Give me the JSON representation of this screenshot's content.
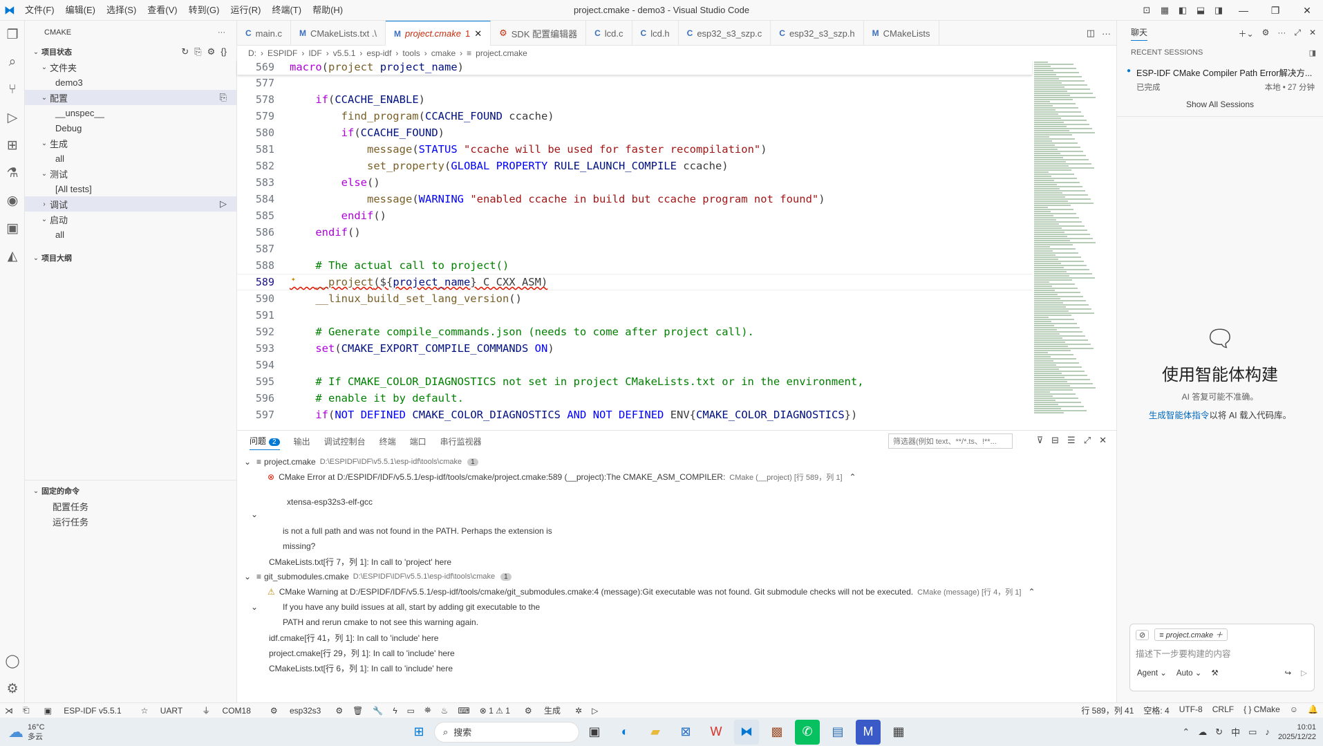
{
  "window": {
    "title": "project.cmake - demo3 - Visual Studio Code",
    "menu": [
      "文件(F)",
      "编辑(E)",
      "选择(S)",
      "查看(V)",
      "转到(G)",
      "运行(R)",
      "终端(T)",
      "帮助(H)"
    ]
  },
  "sidebar": {
    "header": "CMAKE",
    "project_status": "项目状态",
    "folder": "文件夹",
    "folder_item": "demo3",
    "config": "配置",
    "config_items": [
      "__unspec__",
      "Debug"
    ],
    "build": "生成",
    "build_item": "all",
    "test": "测试",
    "test_item": "[All tests]",
    "debug": "调试",
    "launch": "启动",
    "launch_item": "all",
    "outline": "项目大纲",
    "pinned": "固定的命令",
    "pinned_items": [
      "配置任务",
      "运行任务"
    ]
  },
  "tabs": [
    {
      "icon": "C",
      "label": "main.c"
    },
    {
      "icon": "M",
      "label": "CMakeLists.txt .\\"
    },
    {
      "icon": "M",
      "label": "project.cmake",
      "badge": "1"
    },
    {
      "icon": "⚙",
      "label": "SDK 配置编辑器"
    },
    {
      "icon": "C",
      "label": "lcd.c"
    },
    {
      "icon": "C",
      "label": "lcd.h"
    },
    {
      "icon": "C",
      "label": "esp32_s3_szp.c"
    },
    {
      "icon": "C",
      "label": "esp32_s3_szp.h"
    },
    {
      "icon": "M",
      "label": "CMakeLists"
    }
  ],
  "breadcrumbs": [
    "D:",
    "ESPIDF",
    "IDF",
    "v5.5.1",
    "esp-idf",
    "tools",
    "cmake",
    "project.cmake"
  ],
  "sticky_line": {
    "num": "569",
    "text": "macro(project project_name)"
  },
  "code_lines": [
    {
      "num": "577",
      "text": ""
    },
    {
      "num": "578",
      "text": "    if(CCACHE_ENABLE)"
    },
    {
      "num": "579",
      "text": "        find_program(CCACHE_FOUND ccache)"
    },
    {
      "num": "580",
      "text": "        if(CCACHE_FOUND)"
    },
    {
      "num": "581",
      "text": "            message(STATUS \"ccache will be used for faster recompilation\")"
    },
    {
      "num": "582",
      "text": "            set_property(GLOBAL PROPERTY RULE_LAUNCH_COMPILE ccache)"
    },
    {
      "num": "583",
      "text": "        else()"
    },
    {
      "num": "584",
      "text": "            message(WARNING \"enabled ccache in build but ccache program not found\")"
    },
    {
      "num": "585",
      "text": "        endif()"
    },
    {
      "num": "586",
      "text": "    endif()"
    },
    {
      "num": "587",
      "text": ""
    },
    {
      "num": "588",
      "text": "    # The actual call to project()"
    },
    {
      "num": "589",
      "text": "    __project(${project_name} C CXX ASM)"
    },
    {
      "num": "590",
      "text": "    __linux_build_set_lang_version()"
    },
    {
      "num": "591",
      "text": ""
    },
    {
      "num": "592",
      "text": "    # Generate compile_commands.json (needs to come after project call)."
    },
    {
      "num": "593",
      "text": "    set(CMAKE_EXPORT_COMPILE_COMMANDS ON)"
    },
    {
      "num": "594",
      "text": ""
    },
    {
      "num": "595",
      "text": "    # If CMAKE_COLOR_DIAGNOSTICS not set in project CMakeLists.txt or in the environment,"
    },
    {
      "num": "596",
      "text": "    # enable it by default."
    },
    {
      "num": "597",
      "text": "    if(NOT DEFINED CMAKE_COLOR_DIAGNOSTICS AND NOT DEFINED ENV{CMAKE_COLOR_DIAGNOSTICS})"
    }
  ],
  "panel": {
    "tabs": [
      "问题",
      "输出",
      "调试控制台",
      "终端",
      "端口",
      "串行监视器"
    ],
    "problems_count": "2",
    "filter_placeholder": "筛选器(例如 text、**/*.ts、!**...",
    "file1": {
      "name": "project.cmake",
      "path": "D:\\ESPIDF\\IDF\\v5.5.1\\esp-idf\\tools\\cmake",
      "count": "1"
    },
    "error_msg": "CMake Error at D:/ESPIDF/IDF/v5.5.1/esp-idf/tools/cmake/project.cmake:589 (__project):The CMAKE_ASM_COMPILER:",
    "error_src": "CMake (__project) [行 589，列 1]",
    "error_line2": "xtensa-esp32s3-elf-gcc",
    "error_line3": "is not a full path and was not found in the PATH.  Perhaps the extension is",
    "error_line4": "missing?",
    "error_related": "CMakeLists.txt[行 7，列 1]: In call to 'project' here",
    "file2": {
      "name": "git_submodules.cmake",
      "path": "D:\\ESPIDF\\IDF\\v5.5.1\\esp-idf\\tools\\cmake",
      "count": "1"
    },
    "warn_msg": "CMake Warning at D:/ESPIDF/IDF/v5.5.1/esp-idf/tools/cmake/git_submodules.cmake:4 (message):Git executable was not found.  Git submodule checks will not be executed.",
    "warn_src": "CMake (message) [行 4，列 1]",
    "warn_line2": "If you have any build issues at all, start by adding git executable to the",
    "warn_line3": "PATH and rerun cmake to not see this warning again.",
    "warn_related": [
      "idf.cmake[行 41，列 1]: In call to 'include' here",
      "project.cmake[行 29，列 1]: In call to 'include' here",
      "CMakeLists.txt[行 6，列 1]: In call to 'include' here"
    ]
  },
  "chat": {
    "title": "聊天",
    "recent": "RECENT SESSIONS",
    "session_title": "ESP-IDF CMake Compiler Path Error解决方...",
    "session_status": "已完成",
    "session_meta": "本地 • 27 分钟",
    "show_all": "Show All Sessions",
    "hero_title": "使用智能体构建",
    "hero_sub": "AI 答复可能不准确。",
    "hero_link": "生成智能体指令",
    "hero_link_tail": "以将 AI 载入代码库。",
    "context_file": "project.cmake",
    "input_placeholder": "描述下一步要构建的内容",
    "mode": "Agent",
    "model": "Auto"
  },
  "statusbar": {
    "left": [
      "ESP-IDF v5.5.1",
      "UART",
      "COM18",
      "esp32s3",
      "⊗ 1 ⚠ 1",
      "生成"
    ],
    "right": [
      "行 589，列 41",
      "空格: 4",
      "UTF-8",
      "CRLF",
      "{ } CMake"
    ]
  },
  "taskbar": {
    "weather_temp": "16°C",
    "weather_desc": "多云",
    "search": "搜索",
    "time": "10:01",
    "date": "2025/12/22",
    "ime": "中"
  }
}
